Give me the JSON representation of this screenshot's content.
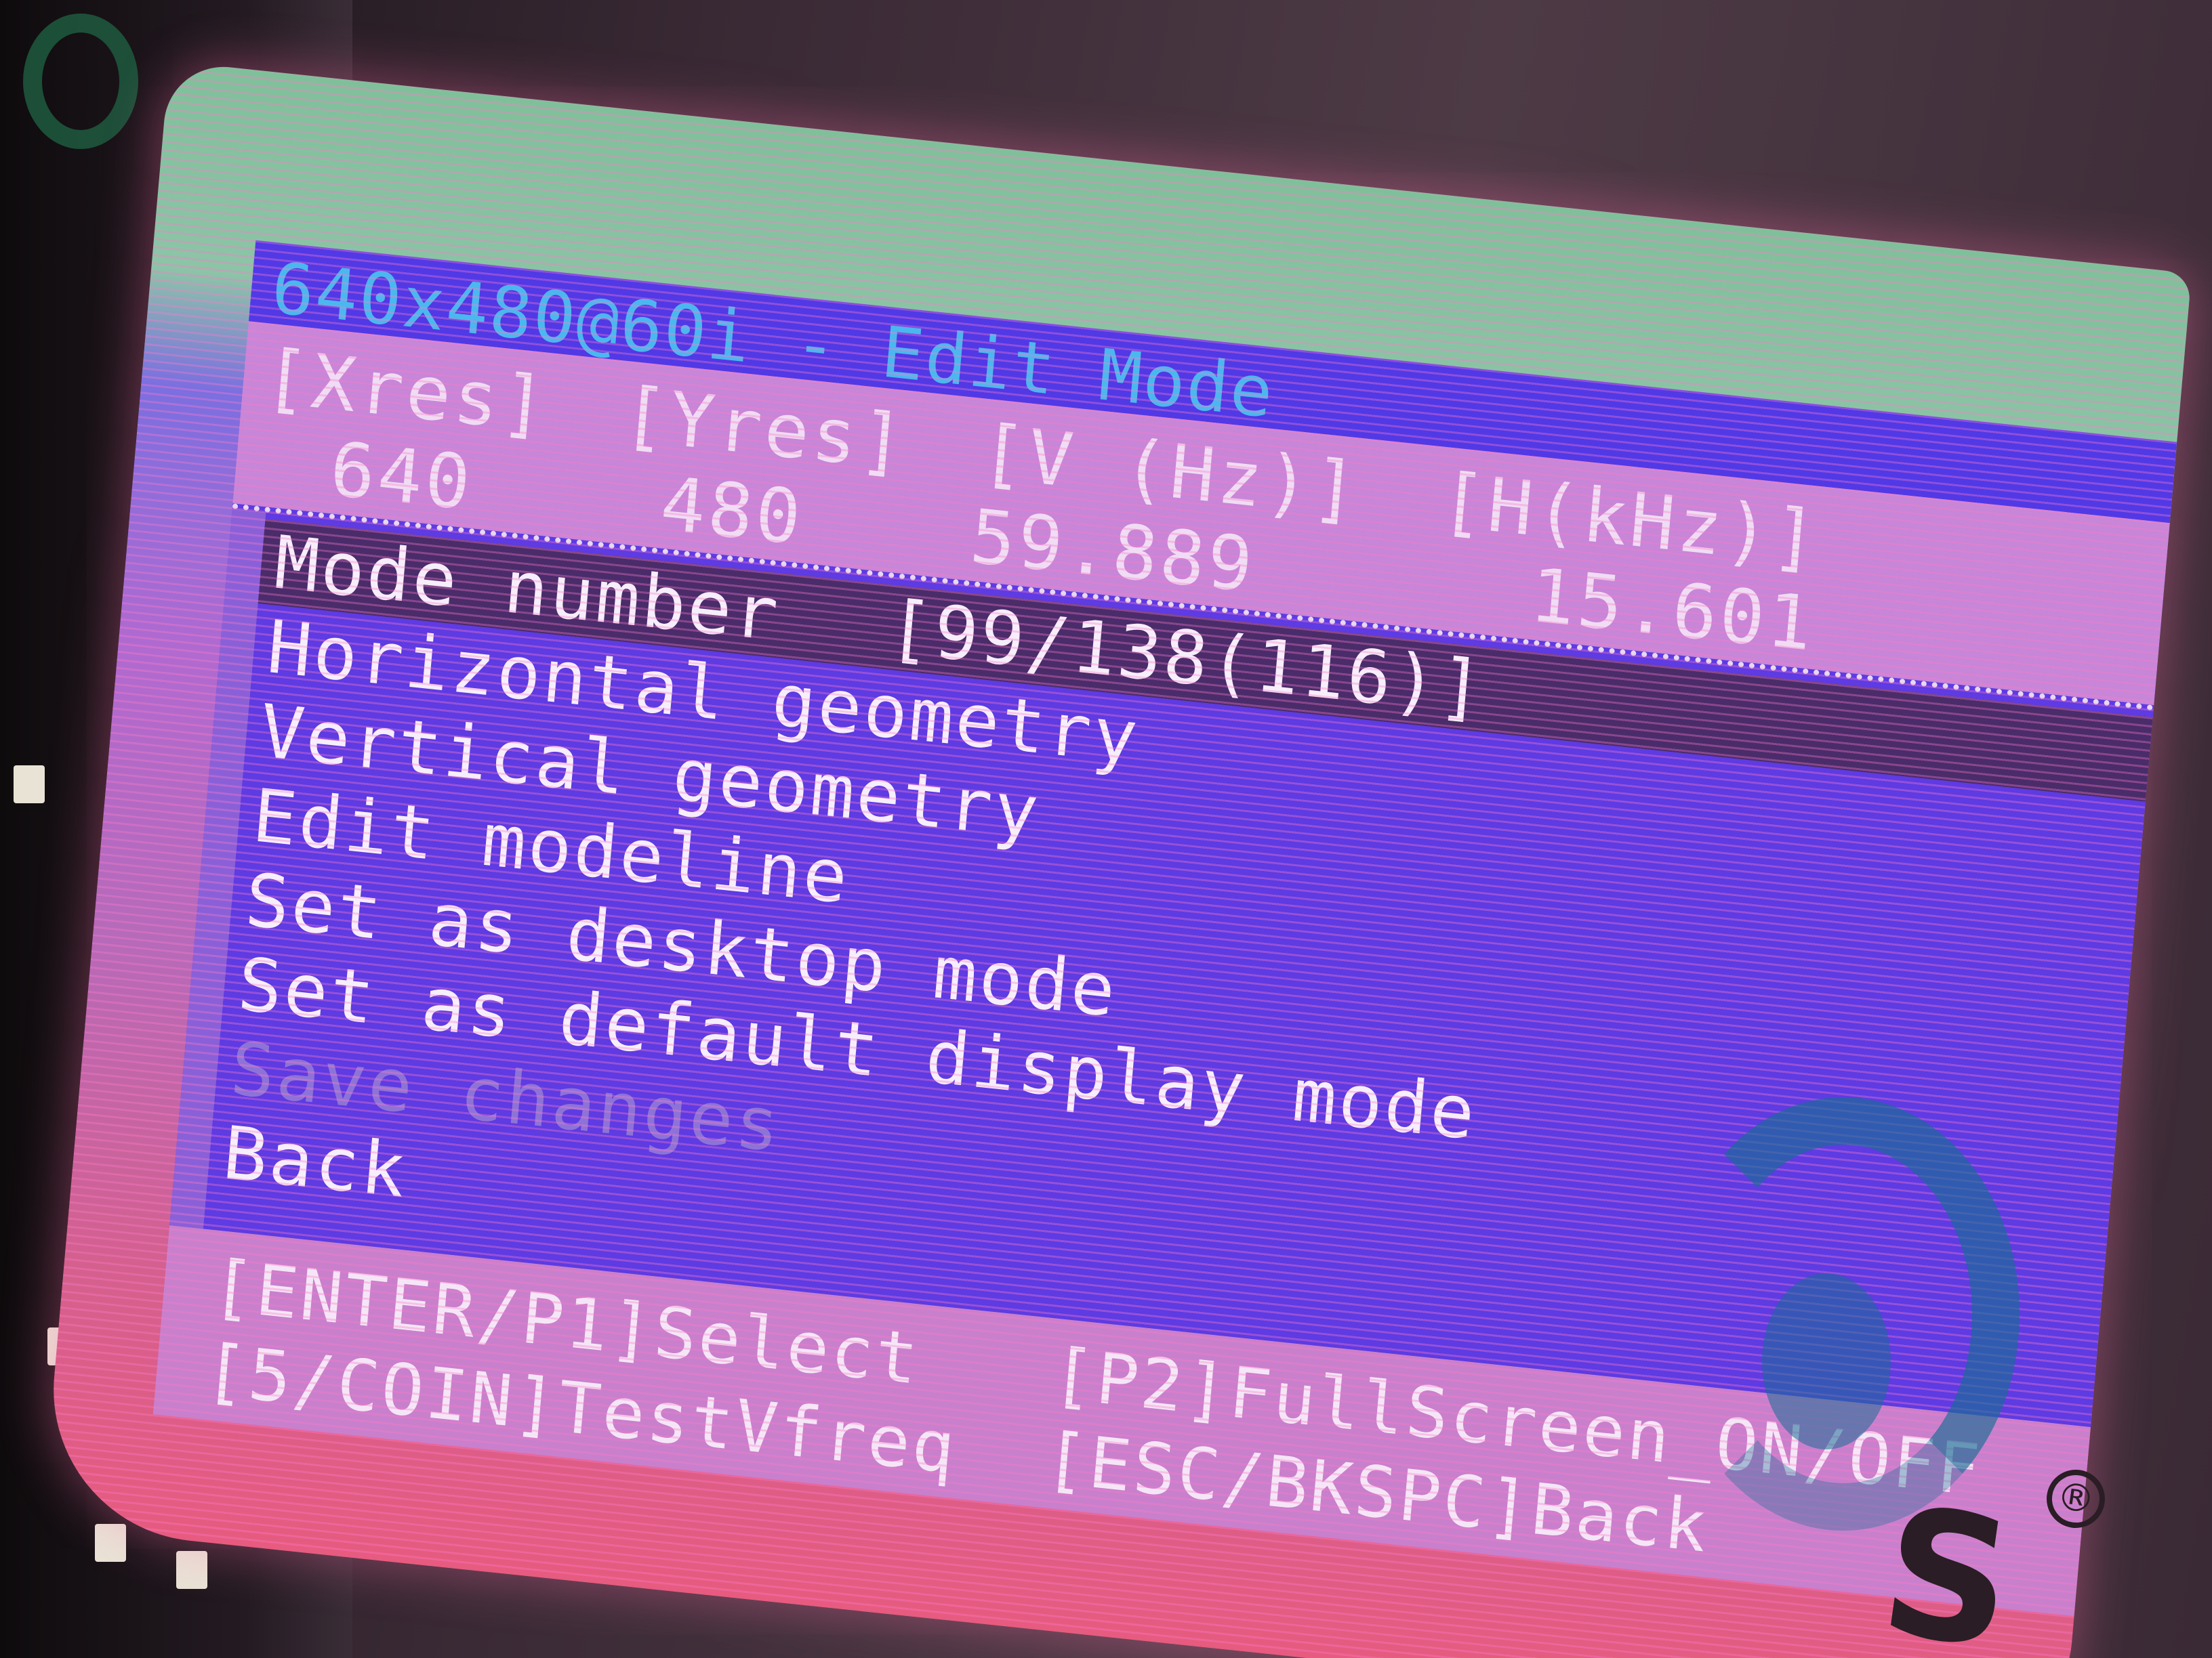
{
  "window": {
    "title": "640x480@60i - Edit Mode"
  },
  "header": {
    "columns": [
      "[Xres]",
      "[Yres]",
      "[V (Hz)]",
      "[H(kHz)]"
    ],
    "values": [
      "640",
      "480",
      "59.889",
      "15.601"
    ]
  },
  "menu": {
    "items": [
      {
        "label": "Mode number",
        "value": "[99/138(116)]",
        "state": "selected"
      },
      {
        "label": "Horizontal geometry",
        "state": "normal"
      },
      {
        "label": "Vertical geometry",
        "state": "normal"
      },
      {
        "label": "Edit modeline",
        "state": "normal"
      },
      {
        "label": "Set as desktop mode",
        "state": "normal"
      },
      {
        "label": "Set as default display mode",
        "state": "normal"
      },
      {
        "label": "Save changes",
        "state": "disabled"
      },
      {
        "label": "Back",
        "state": "normal"
      }
    ]
  },
  "footer": {
    "select_hint": "[ENTER/P1]Select",
    "fullscreen_hint": "[P2]FullScreen_ON/OFF",
    "testvfreq_hint": "[5/COIN]TestVfreq",
    "back_hint": "[ESC/BKSPC]Back"
  },
  "branding": {
    "glyph": "S",
    "registered_mark": "®"
  },
  "colors": {
    "title_bar": "#5139e6",
    "title_text": "#4bb7ef",
    "menu_background": "#5e3be2",
    "selected_row": "#4a2c6a",
    "header_background": "#c786d8",
    "footer_background": "#c880cc"
  }
}
